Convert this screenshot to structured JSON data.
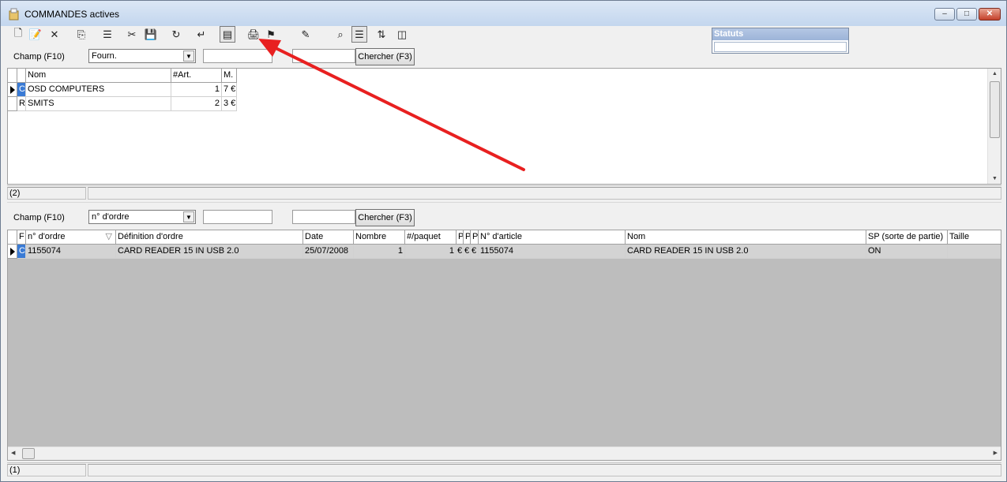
{
  "window": {
    "title": "COMMANDES actives",
    "minimize": "‒",
    "maximize": "□",
    "close": "✕"
  },
  "toolbar": {
    "icons": [
      "new-document-icon",
      "edit-document-icon",
      "delete-icon",
      "copy-icon",
      "properties-icon",
      "filter-icon",
      "save-icon",
      "refresh-icon",
      "import-icon",
      "preview-icon",
      "print-icon",
      "alert-icon",
      "pen-icon",
      "search-icon",
      "list-view-icon",
      "sort-az-icon",
      "columns-icon"
    ],
    "glyphs": [
      "🗋",
      "📝",
      "✕",
      "⎘",
      "☰",
      "✂",
      "💾",
      "↻",
      "↵",
      "▤",
      "🖨",
      "⚑",
      "✎",
      "⌕",
      "☰",
      "⇅",
      "◫"
    ]
  },
  "status_box": {
    "title": "Statuts",
    "value": ""
  },
  "search_top": {
    "field_label": "Champ (F10)",
    "field_value": "Fourn.",
    "text_value": "",
    "text2_value": "",
    "search_button": "Chercher (F3)"
  },
  "top_grid": {
    "columns": [
      "Nom",
      "#Art.",
      "M."
    ],
    "rows": [
      {
        "flag": "C",
        "nom": "OSD COMPUTERS",
        "art": "1",
        "m": "7 €"
      },
      {
        "flag": "R",
        "nom": "SMITS",
        "art": "2",
        "m": "3 €"
      }
    ],
    "status": "(2)"
  },
  "search_bottom": {
    "field_label": "Champ (F10)",
    "field_value": "n° d'ordre",
    "text_value": "",
    "text2_value": "",
    "search_button": "Chercher (F3)"
  },
  "bottom_grid": {
    "columns": [
      "F",
      "n° d'ordre",
      "Définition d'ordre",
      "Date",
      "Nombre",
      "#/paquet",
      "P",
      "P",
      "P",
      "N° d'article",
      "Nom",
      "SP (sorte de partie)",
      "Taille"
    ],
    "sort_indicator": "▽",
    "rows": [
      {
        "f": "C",
        "ordre": "1155074",
        "definition": "CARD READER 15 IN USB 2.0",
        "date": "25/07/2008",
        "nombre": "1",
        "paquet": "1",
        "p1": "€",
        "p2": "€",
        "p3": "€",
        "article": "1155074",
        "nom": "CARD READER 15 IN USB 2.0",
        "sp": "ON",
        "taille": ""
      }
    ],
    "status": "(1)"
  },
  "annotation": {
    "color": "#e82020"
  }
}
